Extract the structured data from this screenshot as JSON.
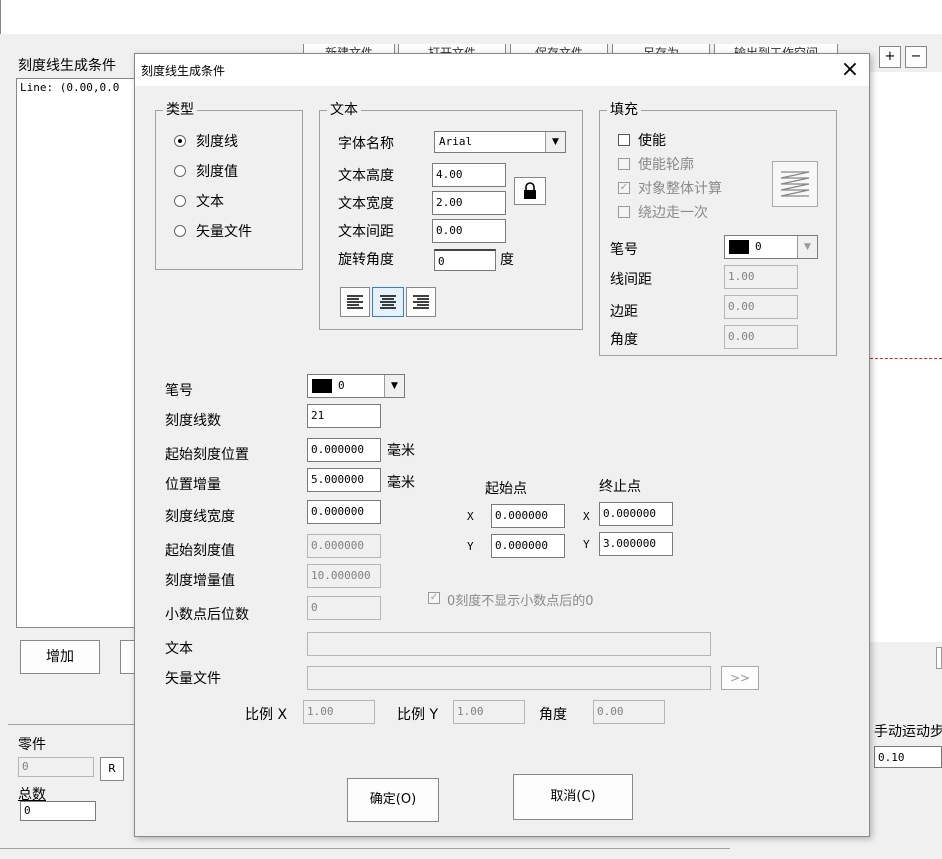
{
  "background": {
    "panel_title": "刻度线生成条件",
    "list_line": "Line: (0.00,0.0",
    "toolbar_buttons": [
      "新建文件",
      "打开文件",
      "保存文件",
      "另存为",
      "输出到工作空间"
    ],
    "plus": "+",
    "minus": "−",
    "add_button": "增加",
    "parts_label": "零件",
    "parts_value": "0",
    "r_button": "R",
    "total_label": "总数",
    "total_value": "0",
    "manual_label": "手动运动步",
    "manual_value": "0.10"
  },
  "dialog": {
    "title": "刻度线生成条件",
    "close": "×",
    "type_group": {
      "title": "类型",
      "options": [
        "刻度线",
        "刻度值",
        "文本",
        "矢量文件"
      ],
      "selected": "刻度线"
    },
    "text_group": {
      "title": "文本",
      "font_label": "字体名称",
      "font_value": "Arial",
      "height_label": "文本高度",
      "height_value": "4.00",
      "width_label": "文本宽度",
      "width_value": "2.00",
      "spacing_label": "文本间距",
      "spacing_value": "0.00",
      "rotate_label": "旋转角度",
      "rotate_value": "0",
      "rotate_unit": "度"
    },
    "fill_group": {
      "title": "填充",
      "enable": "使能",
      "enable_outline": "使能轮廓",
      "whole_calc": "对象整体计算",
      "around_once": "绕边走一次",
      "pen_label": "笔号",
      "pen_value": "0",
      "line_spacing_label": "线间距",
      "line_spacing_value": "1.00",
      "margin_label": "边距",
      "margin_value": "0.00",
      "angle_label": "角度",
      "angle_value": "0.00"
    },
    "main": {
      "pen_label": "笔号",
      "pen_value": "0",
      "count_label": "刻度线数",
      "count_value": "21",
      "start_pos_label": "起始刻度位置",
      "start_pos_value": "0.000000",
      "inc_label": "位置增量",
      "inc_value": "5.000000",
      "unit_mm": "毫米",
      "width_label": "刻度线宽度",
      "width_value": "0.000000",
      "start_val_label": "起始刻度值",
      "start_val_value": "0.000000",
      "inc_val_label": "刻度增量值",
      "inc_val_value": "10.000000",
      "decimals_label": "小数点后位数",
      "decimals_value": "0",
      "start_pt_label": "起始点",
      "end_pt_label": "终止点",
      "x": "X",
      "y": "Y",
      "start_x": "0.000000",
      "start_y": "0.000000",
      "end_x": "0.000000",
      "end_y": "3.000000",
      "zero_check": "0刻度不显示小数点后的0",
      "text_label": "文本",
      "vector_label": "矢量文件",
      "browse": ">>",
      "scale_x_label": "比例 X",
      "scale_x_value": "1.00",
      "scale_y_label": "比例 Y",
      "scale_y_value": "1.00",
      "angle_label": "角度",
      "angle_value": "0.00"
    },
    "ok": "确定(O)",
    "cancel": "取消(C)"
  }
}
